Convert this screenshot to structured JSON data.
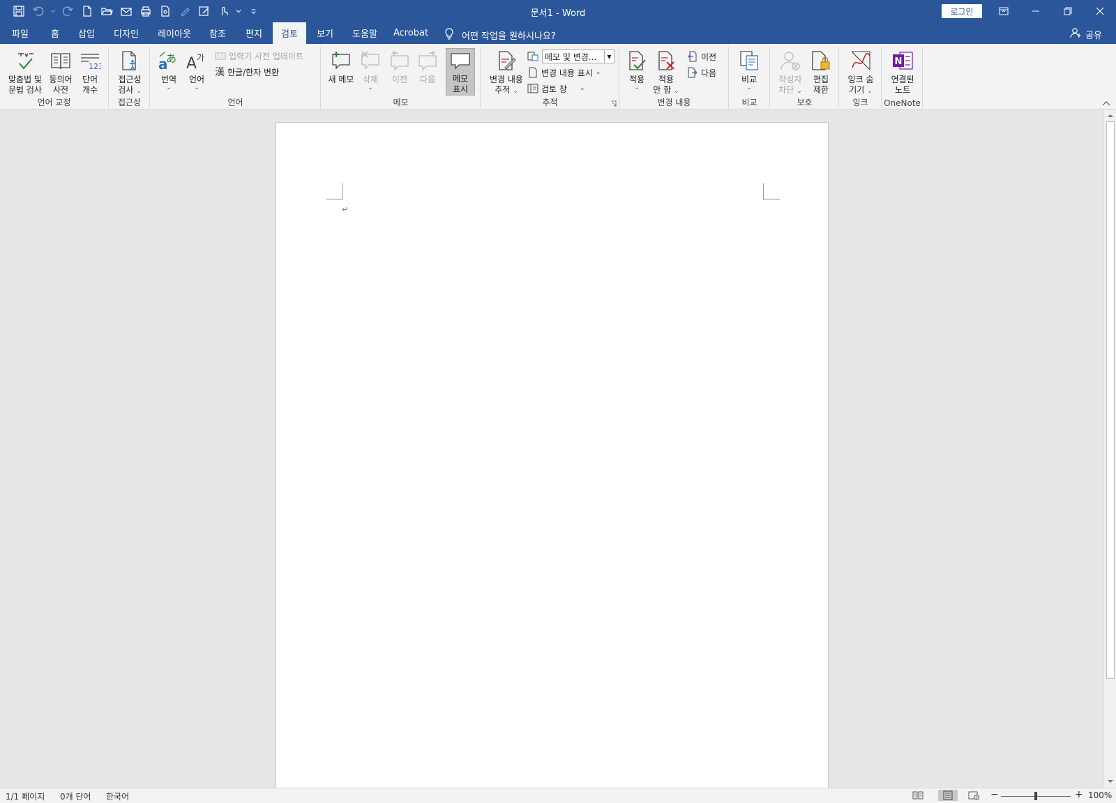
{
  "window": {
    "title": "문서1  -  Word",
    "login_label": "로그인"
  },
  "tabs": [
    {
      "label": "파일"
    },
    {
      "label": "홈"
    },
    {
      "label": "삽입"
    },
    {
      "label": "디자인"
    },
    {
      "label": "레이아웃"
    },
    {
      "label": "참조"
    },
    {
      "label": "편지"
    },
    {
      "label": "검토",
      "active": true
    },
    {
      "label": "보기"
    },
    {
      "label": "도움말"
    },
    {
      "label": "Acrobat"
    }
  ],
  "tell_me": "어떤 작업을 원하시나요?",
  "share_label": "공유",
  "ribbon": {
    "proofing": {
      "label": "언어 교정",
      "spelling_l1": "맞춤법 및",
      "spelling_l2": "문법 검사",
      "thesaurus_l1": "동의어",
      "thesaurus_l2": "사전",
      "wordcount_l1": "단어",
      "wordcount_l2": "개수"
    },
    "accessibility": {
      "label": "접근성",
      "check_l1": "접근성",
      "check_l2": "검사"
    },
    "language": {
      "label": "언어",
      "translate": "번역",
      "language": "언어",
      "ime_update": "입력기 사전 업데이트",
      "hanja": "한글/한자 변환"
    },
    "comments": {
      "label": "메모",
      "new": "새 메모",
      "delete": "삭제",
      "previous": "이전",
      "next": "다음",
      "show_l1": "메모",
      "show_l2": "표시"
    },
    "tracking": {
      "label": "추적",
      "track_l1": "변경 내용",
      "track_l2": "추적",
      "markup_value": "메모 및 변경...",
      "show_markup": "변경 내용 표시",
      "review_pane": "검토 창"
    },
    "changes": {
      "label": "변경 내용",
      "accept": "적용",
      "reject_l1": "적용",
      "reject_l2": "안 함",
      "previous": "이전",
      "next": "다음"
    },
    "compare": {
      "label": "비교",
      "compare": "비교"
    },
    "protect": {
      "label": "보호",
      "block_l1": "작성자",
      "block_l2": "차단",
      "restrict_l1": "편집",
      "restrict_l2": "제한"
    },
    "ink": {
      "label": "잉크",
      "hide_l1": "잉크 숨",
      "hide_l2": "기기"
    },
    "onenote": {
      "label": "OneNote",
      "linked_l1": "연결된",
      "linked_l2": "노트"
    }
  },
  "document": {
    "paragraph_mark": "↵"
  },
  "status": {
    "page": "1/1 페이지",
    "words": "0개 단어",
    "language": "한국어",
    "zoom": "100%",
    "zoom_minus": "−",
    "zoom_plus": "+"
  },
  "colors": {
    "title_bar": "#2b579a",
    "ribbon_bg": "#f3f3f3",
    "canvas_bg": "#e6e6e6",
    "accent_green": "#2e7d32",
    "accent_red": "#c62828",
    "onenote_purple": "#7719aa"
  }
}
